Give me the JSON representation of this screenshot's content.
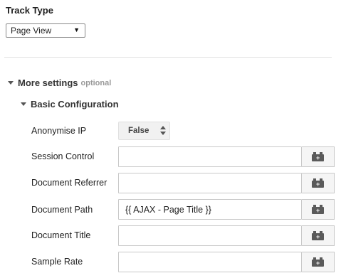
{
  "track_type": {
    "title": "Track Type",
    "selected": "Page View"
  },
  "more_settings": {
    "label": "More settings",
    "optional_label": "optional"
  },
  "basic_configuration": {
    "label": "Basic Configuration",
    "fields": {
      "anonymise_ip": {
        "label": "Anonymise IP",
        "value": "False"
      },
      "session_control": {
        "label": "Session Control",
        "value": ""
      },
      "document_referrer": {
        "label": "Document Referrer",
        "value": ""
      },
      "document_path": {
        "label": "Document Path",
        "value": "{{ AJAX - Page Title }}"
      },
      "document_title": {
        "label": "Document Title",
        "value": ""
      },
      "sample_rate": {
        "label": "Sample Rate",
        "value": ""
      }
    }
  },
  "icons": {
    "variable_picker": "variable-brick-icon",
    "collapse": "triangle-down-icon"
  }
}
